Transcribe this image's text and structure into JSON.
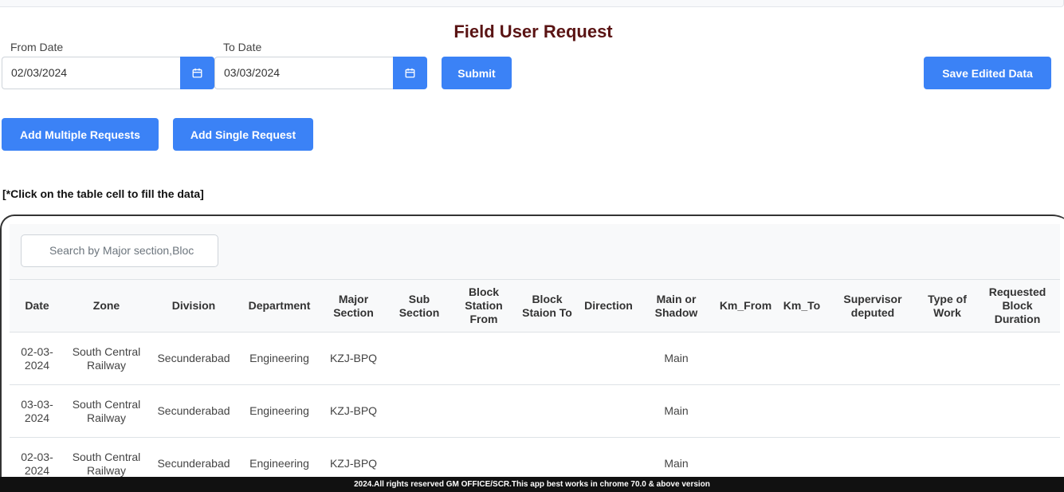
{
  "page": {
    "title": "Field User Request"
  },
  "filters": {
    "from_label": "From Date",
    "from_value": "02/03/2024",
    "to_label": "To Date",
    "to_value": "03/03/2024"
  },
  "buttons": {
    "submit": "Submit",
    "save_edited": "Save Edited Data",
    "add_multiple": "Add Multiple Requests",
    "add_single": "Add Single Request"
  },
  "note": "[*Click on the table cell to fill the data]",
  "search": {
    "placeholder": "Search by Major section,Bloc"
  },
  "table": {
    "headers": [
      "Date",
      "Zone",
      "Division",
      "Department",
      "Major Section",
      "Sub Section",
      "Block Station From",
      "Block Staion To",
      "Direction",
      "Main or Shadow",
      "Km_From",
      "Km_To",
      "Supervisor deputed",
      "Type of Work",
      "Requested Block Duration"
    ],
    "rows": [
      [
        "02-03-2024",
        "South Central Railway",
        "Secunderabad",
        "Engineering",
        "KZJ-BPQ",
        "",
        "",
        "",
        "",
        "Main",
        "",
        "",
        "",
        "",
        ""
      ],
      [
        "03-03-2024",
        "South Central Railway",
        "Secunderabad",
        "Engineering",
        "KZJ-BPQ",
        "",
        "",
        "",
        "",
        "Main",
        "",
        "",
        "",
        "",
        ""
      ],
      [
        "02-03-2024",
        "South Central Railway",
        "Secunderabad",
        "Engineering",
        "KZJ-BPQ",
        "",
        "",
        "",
        "",
        "Main",
        "",
        "",
        "",
        "",
        ""
      ]
    ]
  },
  "footer": "2024.All rights reserved GM OFFICE/SCR.This app best works in chrome 70.0 & above version",
  "colors": {
    "accent": "#3b82f6",
    "title": "#5a1414"
  }
}
